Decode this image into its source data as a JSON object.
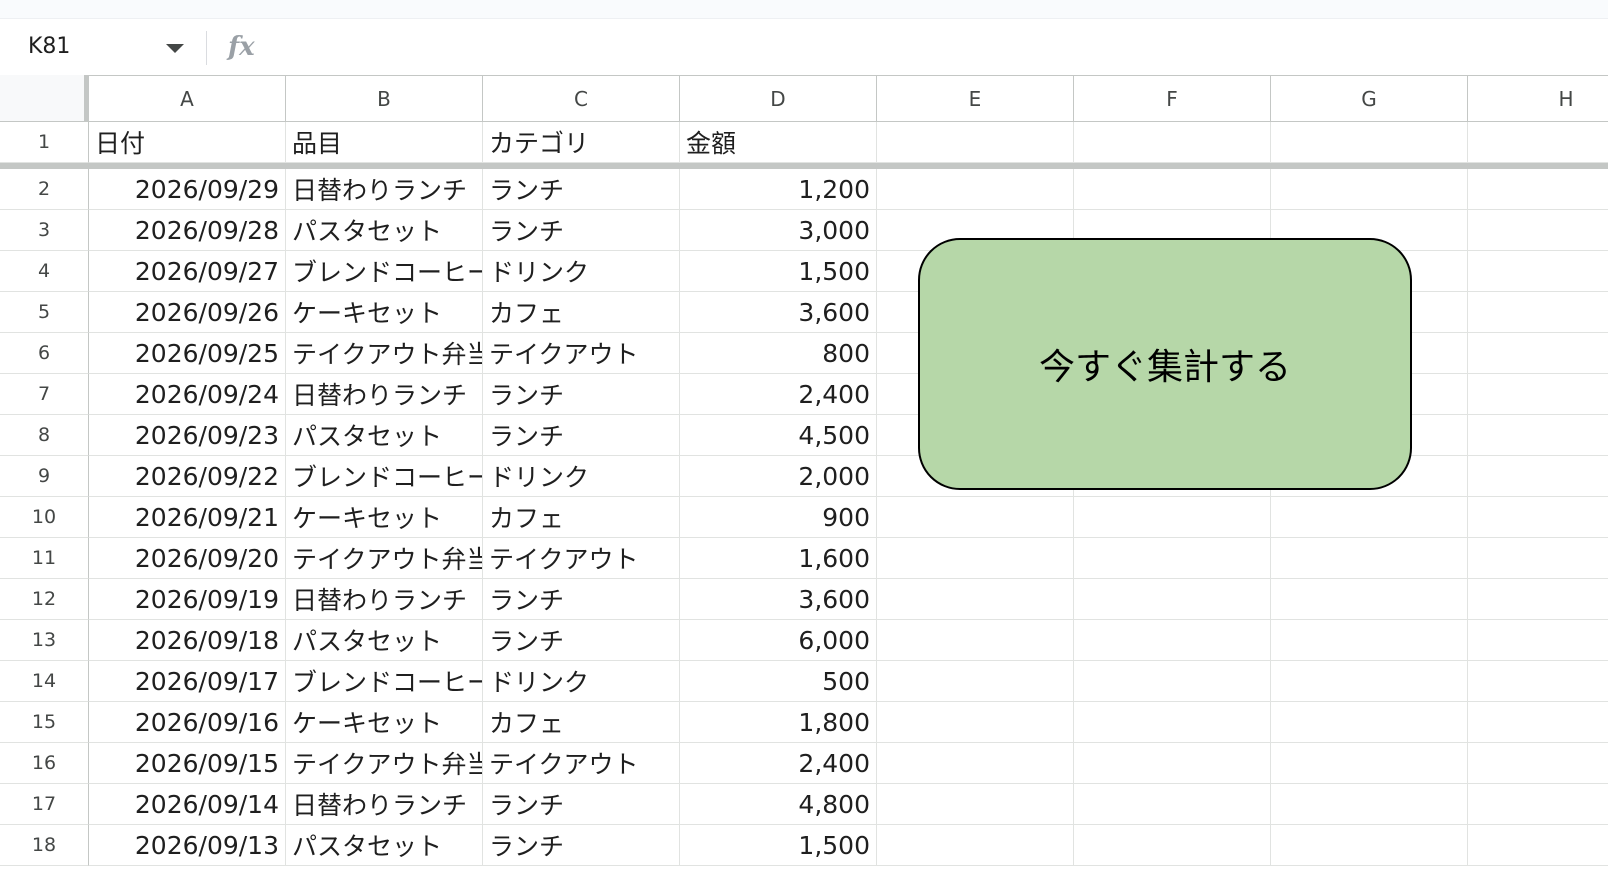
{
  "name_box": {
    "value": "K81"
  },
  "formula_bar": {
    "fx_label": "fx",
    "value": ""
  },
  "columns": [
    "A",
    "B",
    "C",
    "D",
    "E",
    "F",
    "G",
    "H"
  ],
  "header_row": {
    "row_number": "1",
    "cells": [
      "日付",
      "品目",
      "カテゴリ",
      "金額"
    ]
  },
  "rows": [
    {
      "num": "2",
      "date": "2026/09/29",
      "item": "日替わりランチ",
      "category": "ランチ",
      "amount": "1,200"
    },
    {
      "num": "3",
      "date": "2026/09/28",
      "item": "パスタセット",
      "category": "ランチ",
      "amount": "3,000"
    },
    {
      "num": "4",
      "date": "2026/09/27",
      "item": "ブレンドコーヒー",
      "category": "ドリンク",
      "amount": "1,500"
    },
    {
      "num": "5",
      "date": "2026/09/26",
      "item": "ケーキセット",
      "category": "カフェ",
      "amount": "3,600"
    },
    {
      "num": "6",
      "date": "2026/09/25",
      "item": "テイクアウト弁当",
      "category": "テイクアウト",
      "amount": "800"
    },
    {
      "num": "7",
      "date": "2026/09/24",
      "item": "日替わりランチ",
      "category": "ランチ",
      "amount": "2,400"
    },
    {
      "num": "8",
      "date": "2026/09/23",
      "item": "パスタセット",
      "category": "ランチ",
      "amount": "4,500"
    },
    {
      "num": "9",
      "date": "2026/09/22",
      "item": "ブレンドコーヒー",
      "category": "ドリンク",
      "amount": "2,000"
    },
    {
      "num": "10",
      "date": "2026/09/21",
      "item": "ケーキセット",
      "category": "カフェ",
      "amount": "900"
    },
    {
      "num": "11",
      "date": "2026/09/20",
      "item": "テイクアウト弁当",
      "category": "テイクアウト",
      "amount": "1,600"
    },
    {
      "num": "12",
      "date": "2026/09/19",
      "item": "日替わりランチ",
      "category": "ランチ",
      "amount": "3,600"
    },
    {
      "num": "13",
      "date": "2026/09/18",
      "item": "パスタセット",
      "category": "ランチ",
      "amount": "6,000"
    },
    {
      "num": "14",
      "date": "2026/09/17",
      "item": "ブレンドコーヒー",
      "category": "ドリンク",
      "amount": "500"
    },
    {
      "num": "15",
      "date": "2026/09/16",
      "item": "ケーキセット",
      "category": "カフェ",
      "amount": "1,800"
    },
    {
      "num": "16",
      "date": "2026/09/15",
      "item": "テイクアウト弁当",
      "category": "テイクアウト",
      "amount": "2,400"
    },
    {
      "num": "17",
      "date": "2026/09/14",
      "item": "日替わりランチ",
      "category": "ランチ",
      "amount": "4,800"
    },
    {
      "num": "18",
      "date": "2026/09/13",
      "item": "パスタセット",
      "category": "ランチ",
      "amount": "1,500"
    }
  ],
  "button": {
    "label": "今すぐ集計する",
    "fill_color": "#b6d7a8",
    "border_color": "#000000"
  },
  "colors": {
    "header_border": "#c4c7c5",
    "grid_line": "#e1e3e1",
    "header_text": "#444746"
  }
}
